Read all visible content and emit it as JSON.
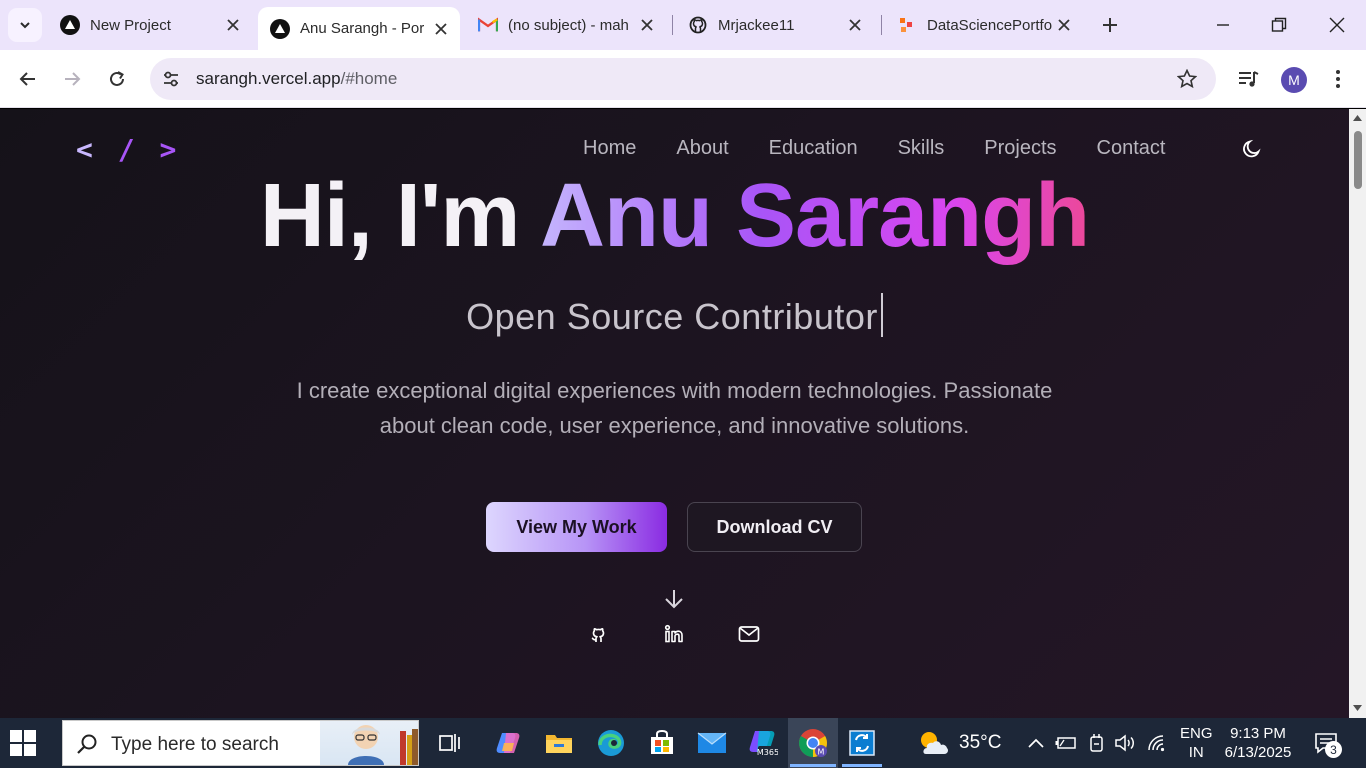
{
  "browser": {
    "tabs": [
      {
        "title": "New Project",
        "favicon": "vercel-triangle-icon",
        "active": false
      },
      {
        "title": "Anu Sarangh - Por",
        "favicon": "vercel-triangle-icon",
        "active": true
      },
      {
        "title": "(no subject) - mah",
        "favicon": "gmail-icon",
        "active": false
      },
      {
        "title": "Mrjackee11",
        "favicon": "github-icon",
        "active": false
      },
      {
        "title": "DataSciencePortfo",
        "favicon": "slides-icon",
        "active": false
      }
    ],
    "url_host": "sarangh.vercel.app",
    "url_path": "/#home",
    "profile_initial": "M"
  },
  "site": {
    "logo": {
      "open": "<",
      "slash": "/",
      "close": ">"
    },
    "nav": [
      "Home",
      "About",
      "Education",
      "Skills",
      "Projects",
      "Contact"
    ],
    "hero": {
      "greeting": "Hi, I'm ",
      "name": "Anu Sarangh",
      "role": "Open Source Contributor",
      "description_line1": "I create exceptional digital experiences with modern technologies. Passionate",
      "description_line2": "about clean code, user experience, and innovative solutions."
    },
    "buttons": {
      "primary": "View My Work",
      "secondary": "Download CV"
    },
    "socials": [
      "github-icon",
      "linkedin-icon",
      "mail-icon"
    ]
  },
  "taskbar": {
    "search_placeholder": "Type here to search",
    "temperature": "35°C",
    "lang_line1": "ENG",
    "lang_line2": "IN",
    "time": "9:13 PM",
    "date": "6/13/2025",
    "notification_count": "3"
  },
  "colors": {
    "accent": "#a855f7",
    "pink": "#ec4899",
    "page_bg": "#1c1420"
  }
}
